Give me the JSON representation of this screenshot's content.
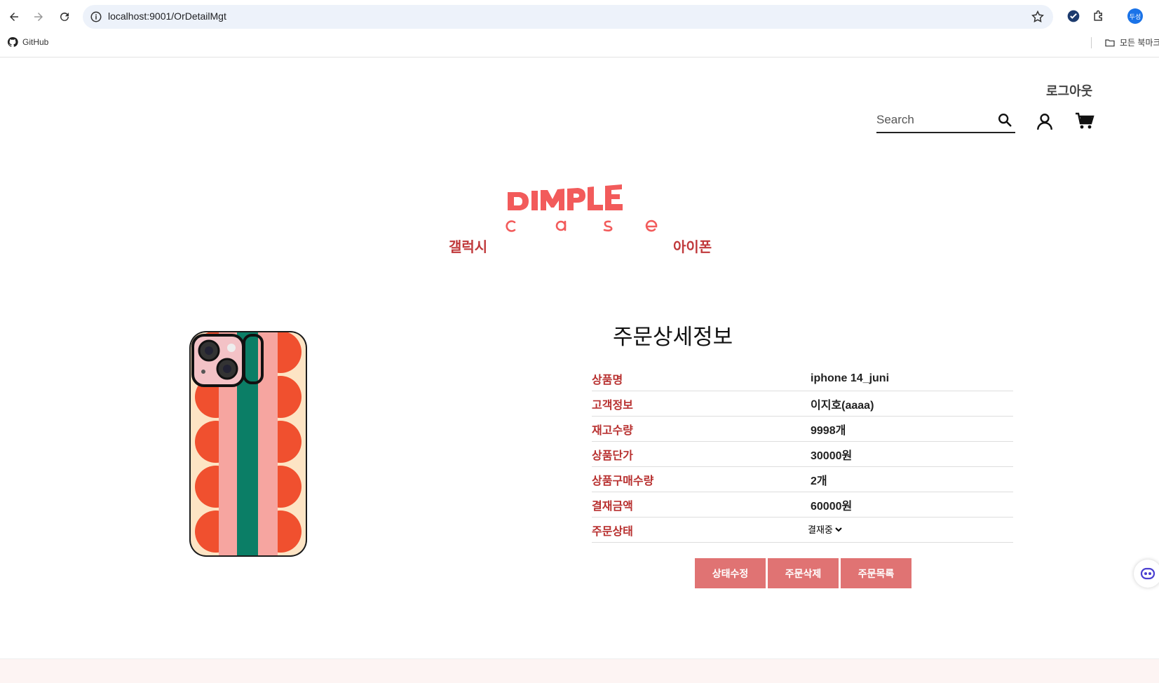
{
  "browser": {
    "url": "localhost:9001/OrDetailMgt",
    "profile_initial": "두성",
    "bookmarks": [
      {
        "label": "GitHub",
        "icon": "github-icon"
      }
    ],
    "all_bookmarks_label": "모든 북마크"
  },
  "header": {
    "logout_label": "로그아웃",
    "search_placeholder": "Search",
    "logo": {
      "line1": "DIMPLE",
      "line2": "c a s e",
      "color": "#f25b5b"
    }
  },
  "nav": {
    "items": [
      {
        "label": "갤럭시"
      },
      {
        "label": "아이폰"
      }
    ]
  },
  "detail": {
    "title": "주문상세정보",
    "rows": [
      {
        "key": "상품명",
        "value": "iphone 14_juni"
      },
      {
        "key": "고객정보",
        "value": "이지호(aaaa)"
      },
      {
        "key": "재고수량",
        "value": "9998개"
      },
      {
        "key": "상품단가",
        "value": "30000원"
      },
      {
        "key": "상품구매수량",
        "value": "2개"
      },
      {
        "key": "결재금액",
        "value": "60000원"
      },
      {
        "key": "주문상태",
        "value": "결재중"
      }
    ],
    "status_selected": "결재중"
  },
  "buttons": {
    "edit_status": "상태수정",
    "delete_order": "주문삭제",
    "order_list": "주문목록"
  },
  "colors": {
    "accent": "#c0393b",
    "button": "#e07373",
    "logo": "#f25b5b"
  }
}
